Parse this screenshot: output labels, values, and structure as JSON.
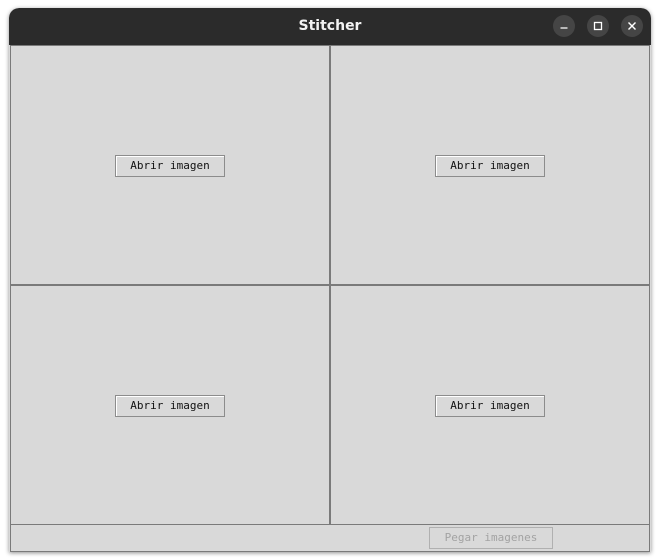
{
  "window": {
    "title": "Stitcher",
    "controls": [
      "minimize-icon",
      "maximize-icon",
      "close-icon"
    ]
  },
  "panes": [
    {
      "button_label": "Abrir imagen"
    },
    {
      "button_label": "Abrir imagen"
    },
    {
      "button_label": "Abrir imagen"
    },
    {
      "button_label": "Abrir imagen"
    }
  ],
  "bottom": {
    "paste_label": "Pegar imagenes",
    "paste_enabled": false
  },
  "colors": {
    "titlebar": "#2b2b2b",
    "background": "#d9d9d9",
    "disabled_text": "#a3a3a3"
  }
}
